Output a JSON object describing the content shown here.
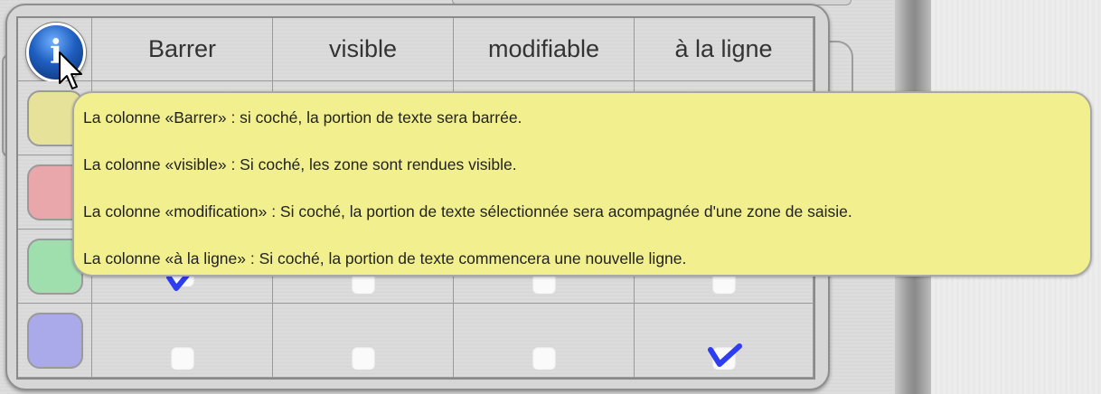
{
  "table": {
    "headers": [
      "Barrer",
      "visible",
      "modifiable",
      "à la ligne"
    ],
    "rows": [
      {
        "color": "#e6e29a",
        "checks": [
          false,
          false,
          false,
          false
        ]
      },
      {
        "color": "#e9a6ab",
        "checks": [
          false,
          false,
          false,
          false
        ]
      },
      {
        "color": "#9fdfae",
        "checks": [
          true,
          false,
          false,
          false
        ]
      },
      {
        "color": "#aaaaea",
        "checks": [
          false,
          false,
          false,
          true
        ]
      }
    ]
  },
  "info_button": {
    "icon": "info-icon",
    "glyph": "i"
  },
  "tooltip": {
    "lines": [
      "La colonne «Barrer» : si coché, la portion de texte sera barrée.",
      "La colonne «visible» : Si coché, les zone sont rendues visible.",
      "La colonne «modification» : Si coché, la portion de texte sélectionnée sera acompagnée d'une zone de saisie.",
      "La colonne «à la ligne» : Si coché, la portion de texte commencera une nouvelle ligne."
    ]
  },
  "colors": {
    "check_mark": "#2e3df0",
    "tooltip_bg": "#f2ef8f",
    "info_blue": "#1f5fc0"
  }
}
